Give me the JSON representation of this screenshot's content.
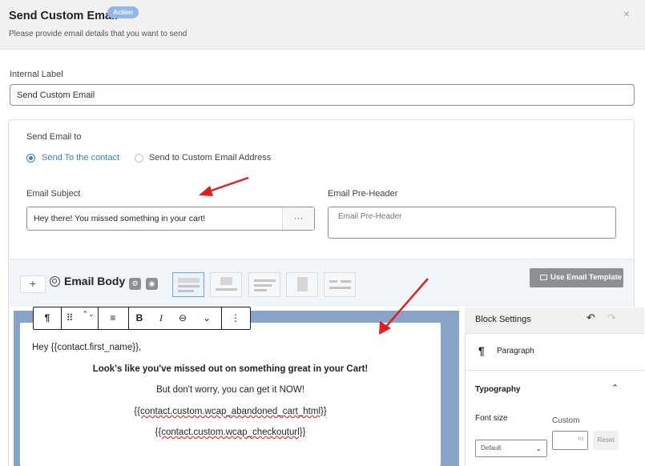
{
  "header": {
    "title": "Send Custom Email",
    "badge": "Action",
    "subtitle": "Please provide email details that you want to send",
    "close_glyph": "×"
  },
  "internal_label": {
    "label": "Internal Label",
    "value": "Send Custom Email"
  },
  "send_to": {
    "label": "Send Email to",
    "options": [
      {
        "label": "Send To the contact",
        "selected": true
      },
      {
        "label": "Send to Custom Email Address",
        "selected": false
      }
    ]
  },
  "subject": {
    "label": "Email Subject",
    "value": "Hey there! You missed something in your cart!",
    "more_glyph": "···"
  },
  "preheader": {
    "label": "Email Pre-Header",
    "placeholder": "Email Pre-Header"
  },
  "email_body": {
    "add_glyph": "+",
    "title": "Email Body",
    "use_template_label": "Use Email Template"
  },
  "toolbar": {
    "paragraph_glyph": "¶",
    "drag_glyph": "⠿",
    "move_glyph": "⌃⌄",
    "align_glyph": "≡",
    "bold_glyph": "B",
    "italic_glyph": "I",
    "link_glyph": "⊖",
    "more_text_glyph": "⌄",
    "options_glyph": "⋮"
  },
  "email_content": {
    "greeting": "Hey {{contact.first_name}},",
    "headline": "Look's like you've missed out on something great in your Cart!",
    "body": "But don't worry, you can get it NOW!",
    "merge_html": "{{contact.custom.wcap_abandoned_cart_html}}",
    "merge_url": "{{contact.custom.wcap_checkouturl}}"
  },
  "block_settings": {
    "title": "Block Settings",
    "undo_glyph": "↶",
    "redo_glyph": "↷",
    "block_glyph": "¶",
    "block_name": "Paragraph",
    "typography_label": "Typography",
    "typography_chevron": "⌃",
    "font_size_label": "Font size",
    "custom_label": "Custom",
    "font_size_select": "Default",
    "select_chevron": "⌄",
    "unit": "PX",
    "reset_label": "Reset"
  },
  "colors": {
    "accent": "#3582c4",
    "badge": "#8eb8ea",
    "annotation_arrow": "#e02020",
    "canvas_background": "#87a4c7"
  }
}
